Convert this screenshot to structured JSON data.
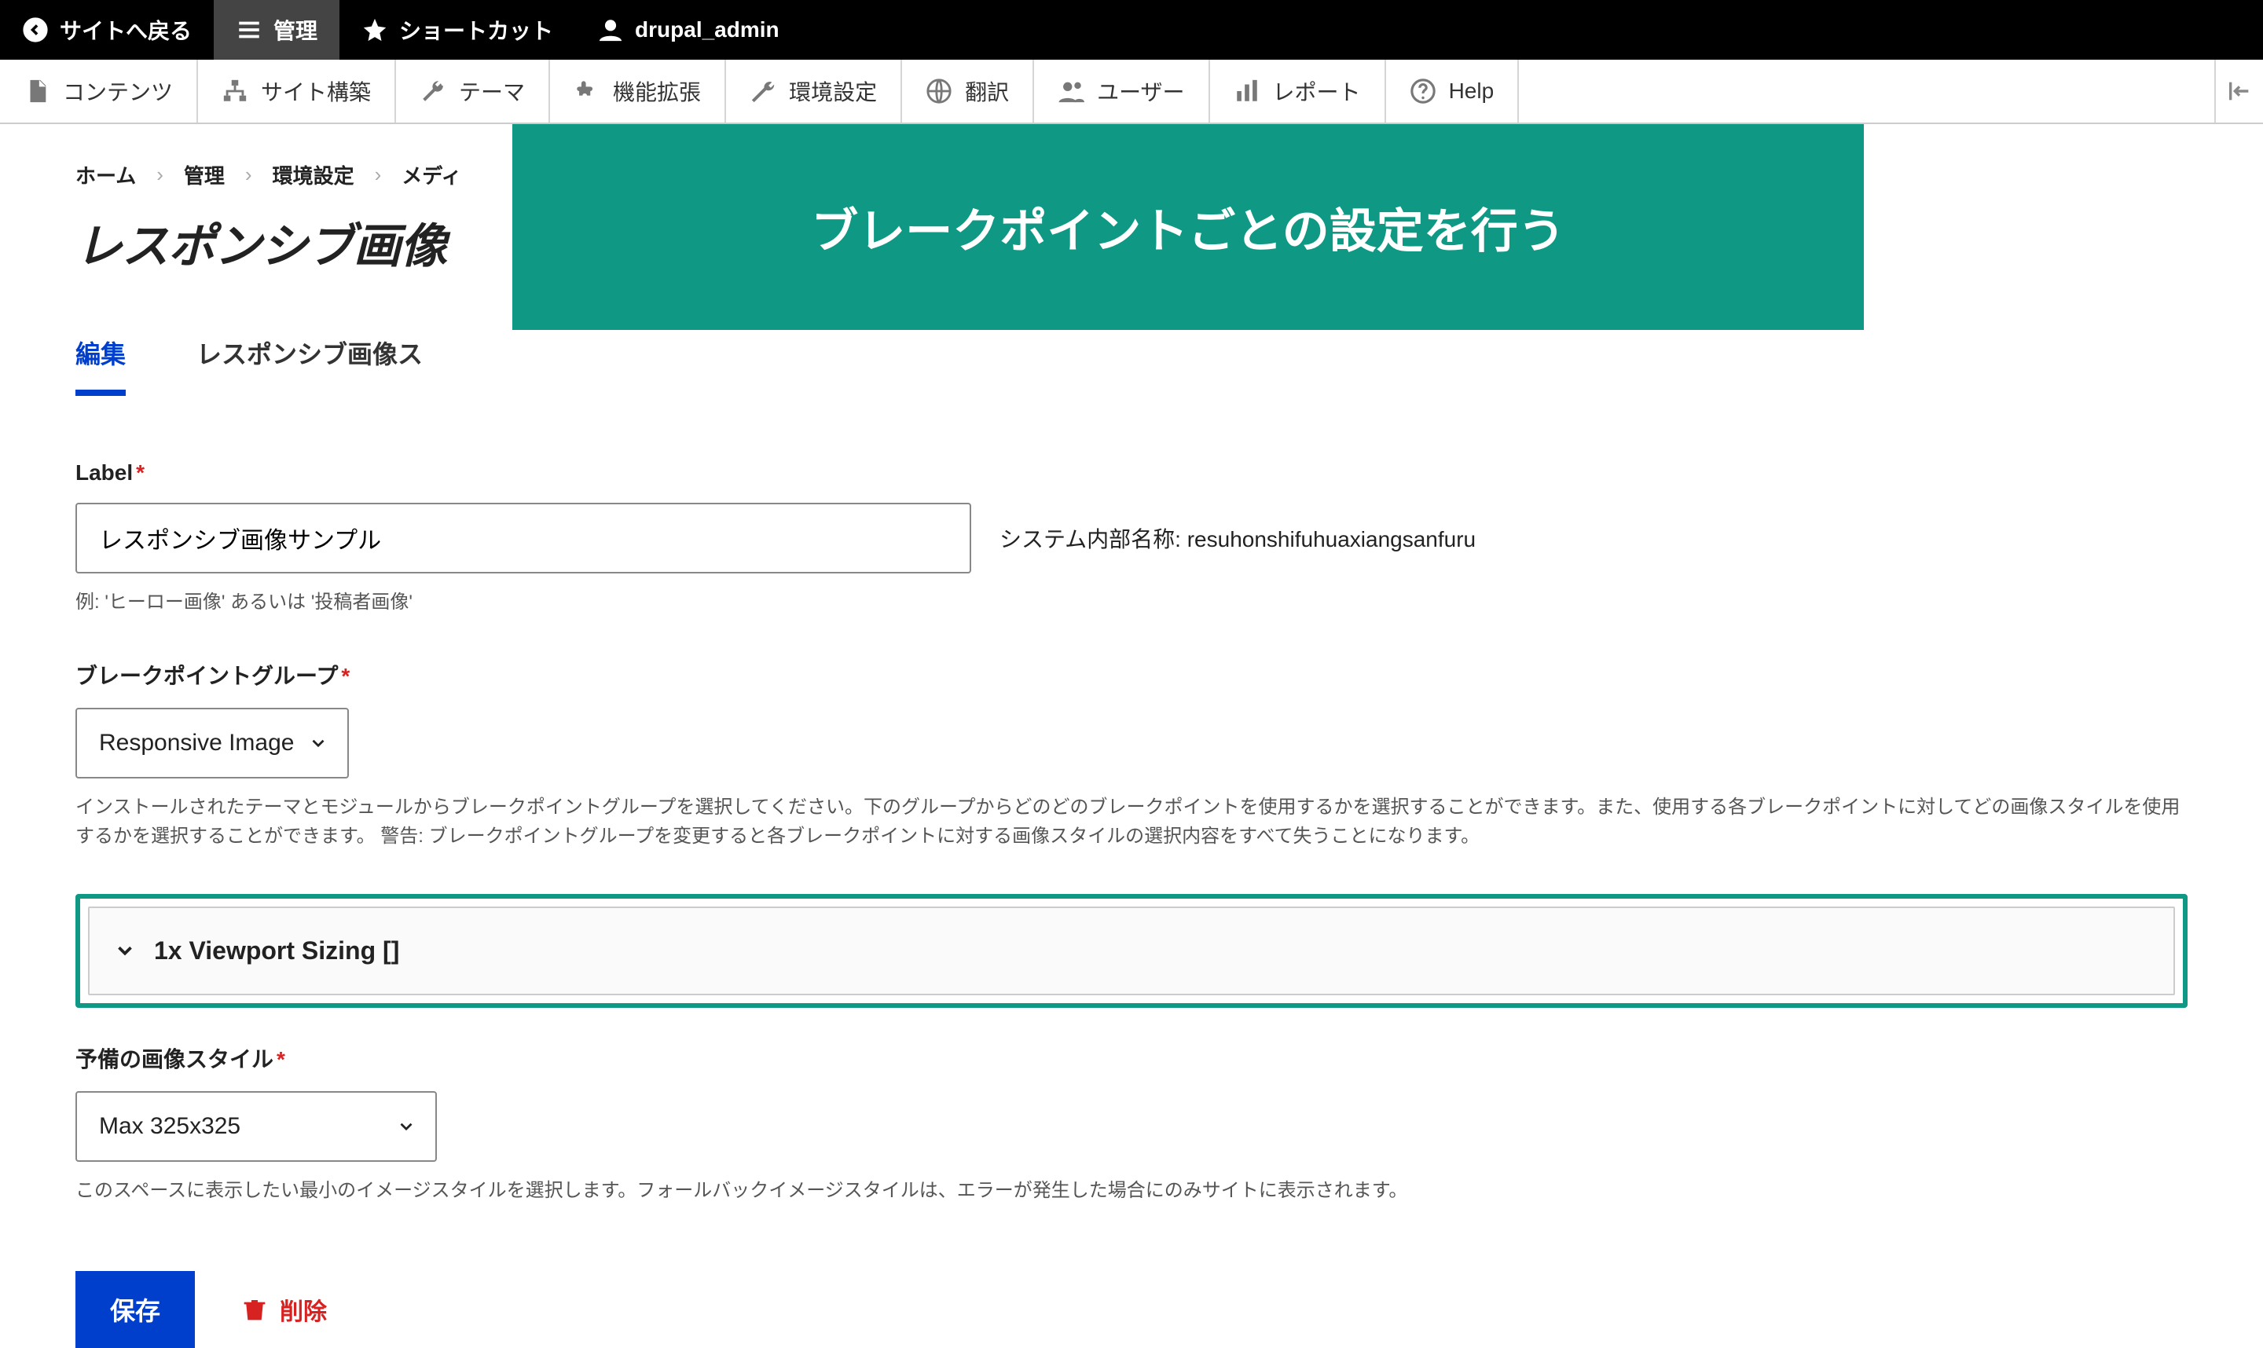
{
  "top_admin": {
    "back_label": "サイトへ戻る",
    "manage_label": "管理",
    "shortcut_label": "ショートカット",
    "user_label": "drupal_admin"
  },
  "toolbar": {
    "content": "コンテンツ",
    "structure": "サイト構築",
    "appearance": "テーマ",
    "extend": "機能拡張",
    "config": "環境設定",
    "translate": "翻訳",
    "people": "ユーザー",
    "reports": "レポート",
    "help": "Help"
  },
  "breadcrumb": [
    "ホーム",
    "管理",
    "環境設定",
    "メディ"
  ],
  "page_title": "レスポンシブ画像",
  "overlay_banner": "ブレークポイントごとの設定を行う",
  "tabs": {
    "edit": "編集",
    "second": "レスポンシブ画像ス"
  },
  "label_field": {
    "label": "Label",
    "value": "レスポンシブ画像サンプル",
    "machine_name_prefix": "システム内部名称: ",
    "machine_name": "resuhonshifuhuaxiangsanfuru",
    "help": "例: 'ヒーロー画像' あるいは '投稿者画像'"
  },
  "breakpoint_group": {
    "label": "ブレークポイントグループ",
    "selected": "Responsive Image",
    "help": "インストールされたテーマとモジュールからブレークポイントグループを選択してください。下のグループからどのどのブレークポイントを使用するかを選択することができます。また、使用する各ブレークポイントに対してどの画像スタイルを使用するかを選択することができます。 警告: ブレークポイントグループを変更すると各ブレークポイントに対する画像スタイルの選択内容をすべて失うことになります。"
  },
  "details_summary": "1x Viewport Sizing []",
  "fallback": {
    "label": "予備の画像スタイル",
    "selected": "Max 325x325",
    "help": "このスペースに表示したい最小のイメージスタイルを選択します。フォールバックイメージスタイルは、エラーが発生した場合にのみサイトに表示されます。"
  },
  "actions": {
    "save": "保存",
    "delete": "削除"
  }
}
